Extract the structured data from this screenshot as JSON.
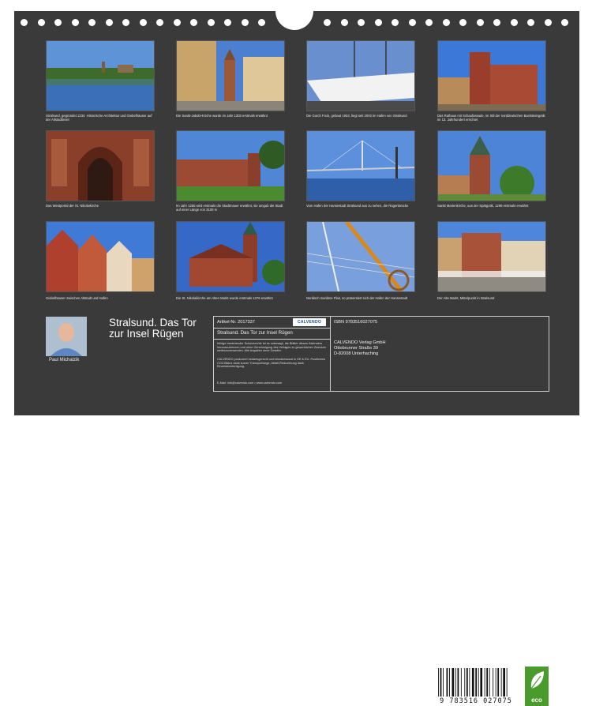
{
  "captions": {
    "c1": "Stralsund, gegründet 1234. Historische Architektur und Giebelhäuser auf der Altstadtinsel",
    "c2": "Die Sankt-Jakobi-Kirche wurde im Jahr 1303 erstmals erwähnt",
    "c3": "Die Gorch Fock, gebaut 1933, liegt seit 2003 im Hafen von Stralsund",
    "c4": "Das Rathaus mit Schaufassade, im Stil der norddeutschen Backsteingotik im 13. Jahrhundert errichtet",
    "c5": "Das Westportal der St. Nikolaikirche",
    "c6": "Im Jahr 1256 wird erstmals die Stadtmauer erwähnt, sie umgab die Stadt auf einer Länge von 3100 m",
    "c7": "Vom Hafen der Hansestadt Stralsund aus zu sehen, die Rügenbrücke",
    "c8": "Sankt Marienkirche, aus der Spätgotik, 1298 erstmals erwähnt",
    "c9": "Giebelhäuser zwischen Altstadt und Hafen",
    "c10": "Die St. Nikolaikirche am Alten Markt wurde erstmals 1276 erwähnt",
    "c11": "Nordisch maritime Flair, so präsentiert sich der Hafen der Hansestadt",
    "c12": "Der Alte Markt, Mittelpunkt in Stralsund"
  },
  "author": {
    "name": "Paul Michalzik"
  },
  "title": "Stralsund. Das Tor zur Insel Rügen",
  "info": {
    "article_no": "Artikel-Nr. 2017337",
    "logo": "CALVENDO",
    "subtitle": "Stralsund. Das Tor zur Insel Rügen",
    "copyright": "Infolge bestehender Schutzrechte ist es untersagt, die Blätter dieses Kalenders herauszutrennen und ohne Genehmigung des Verlages zu gewerblichen Zwecken weiterzuverwenden. Alle Angaben ohne Gewähr.",
    "eco_text": "CALVENDO produziert bedarfsgerecht und klimabewusst in DE & EU. Positiveres CO2-Bilanz dank kurzer Transportwege, Abfall-Reduzierung dank Einzelstückfertigung.",
    "email": "E-Mail: info@calvendo.com • www.calvendo.com",
    "isbn": "ISBN 9783516027075",
    "publisher_1": "CALVENDO Verlag GmbH",
    "publisher_2": "Ottobrunner Straße 39",
    "publisher_3": "D-82008 Unterhaching",
    "barcode_number": "9 783516 027075",
    "eco_label": "eco"
  }
}
